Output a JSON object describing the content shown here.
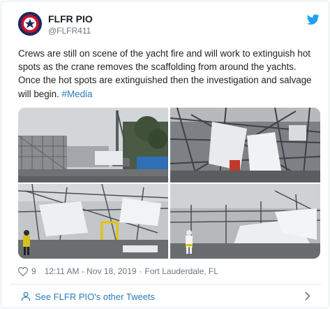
{
  "author": {
    "name": "FLFR PIO",
    "handle": "@FLFR411"
  },
  "tweet": {
    "text": "Crews are still on scene of the yacht fire and will work to extinguish hot spots as the crane removes the scaffolding from around the yachts. Once the hot spots are extinguished then the investigation and salvage will begin. ",
    "hashtag": "#Media"
  },
  "meta": {
    "likes": "9",
    "timestamp": "12:11 AM - Nov 18, 2019",
    "location": "Fort Lauderdale, FL"
  },
  "footer": {
    "more_tweets_label": "See FLFR PIO's other Tweets"
  },
  "icons": {
    "brand": "twitter-bird-icon",
    "like": "heart-icon",
    "profile": "person-icon",
    "arrow": "chevron-right-icon"
  },
  "colors": {
    "link": "#2b7bb9",
    "twitter_blue": "#1da1f2",
    "muted_text": "#697882"
  }
}
